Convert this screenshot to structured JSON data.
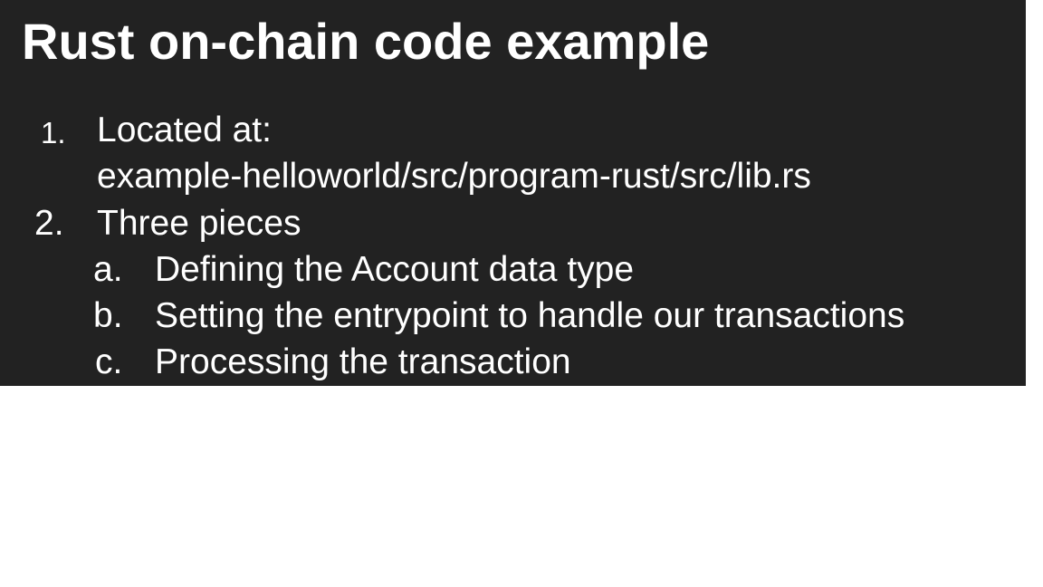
{
  "slide": {
    "title": "Rust on-chain code example",
    "items": [
      {
        "marker": "1.",
        "text": "Located at:",
        "continuation": "example-helloworld/src/program-rust/src/lib.rs"
      },
      {
        "marker": "2.",
        "text": "Three pieces",
        "subitems": [
          {
            "marker": "a.",
            "text": "Defining the Account data type"
          },
          {
            "marker": "b.",
            "text": "Setting the entrypoint to handle our transactions"
          },
          {
            "marker": "c.",
            "text": "Processing the transaction"
          }
        ]
      }
    ]
  }
}
